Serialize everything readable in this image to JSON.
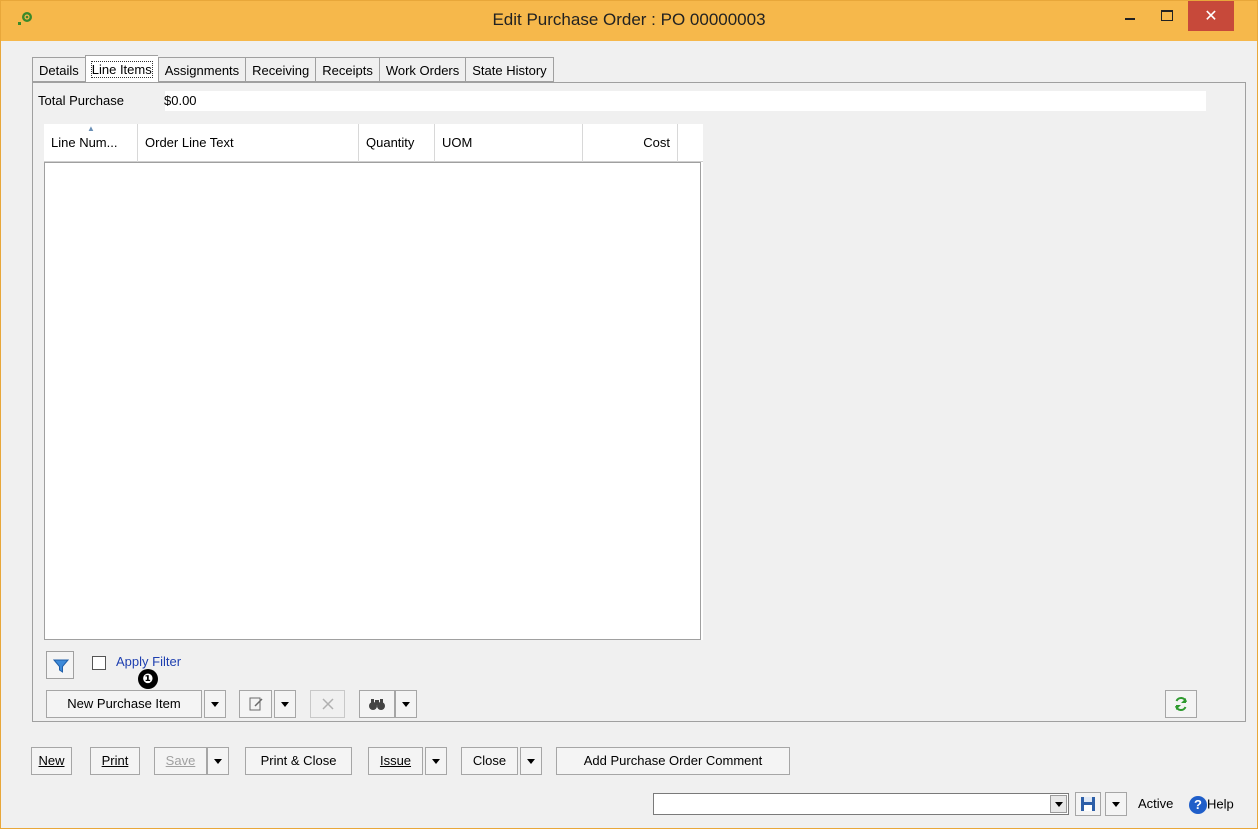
{
  "window": {
    "title": "Edit Purchase Order : PO 00000003",
    "icon": "app-status-icon",
    "controls": {
      "minimize": "_",
      "maximize": "□",
      "close": "✕"
    },
    "accent_color": "#f6b84b",
    "close_color": "#c7493a"
  },
  "tabs": [
    {
      "label": "Details",
      "active": false
    },
    {
      "label": "Line Items",
      "active": true
    },
    {
      "label": "Assignments",
      "active": false
    },
    {
      "label": "Receiving",
      "active": false
    },
    {
      "label": "Receipts",
      "active": false
    },
    {
      "label": "Work Orders",
      "active": false
    },
    {
      "label": "State History",
      "active": false
    }
  ],
  "total": {
    "label": "Total Purchase",
    "value": "$0.00"
  },
  "grid": {
    "columns": [
      "Line Num...",
      "Order Line Text",
      "Quantity",
      "UOM",
      "Cost"
    ],
    "rows": []
  },
  "filter": {
    "apply_label": "Apply Filter",
    "checked": false,
    "icon": "filter-icon"
  },
  "callout": {
    "label": "❶"
  },
  "line_toolbar": {
    "new_item": "New Purchase Item",
    "edit_icon": "edit-icon",
    "delete_icon": "delete-icon",
    "find_icon": "binoculars-icon",
    "refresh_icon": "refresh-icon"
  },
  "bottom_toolbar": {
    "new": "New",
    "print": "Print",
    "save": "Save",
    "print_close": "Print & Close",
    "issue": "Issue",
    "close": "Close",
    "add_comment": "Add Purchase Order Comment"
  },
  "status": {
    "combo_value": "",
    "state": "Active",
    "help": "Help",
    "save_icon": "floppy-icon"
  }
}
